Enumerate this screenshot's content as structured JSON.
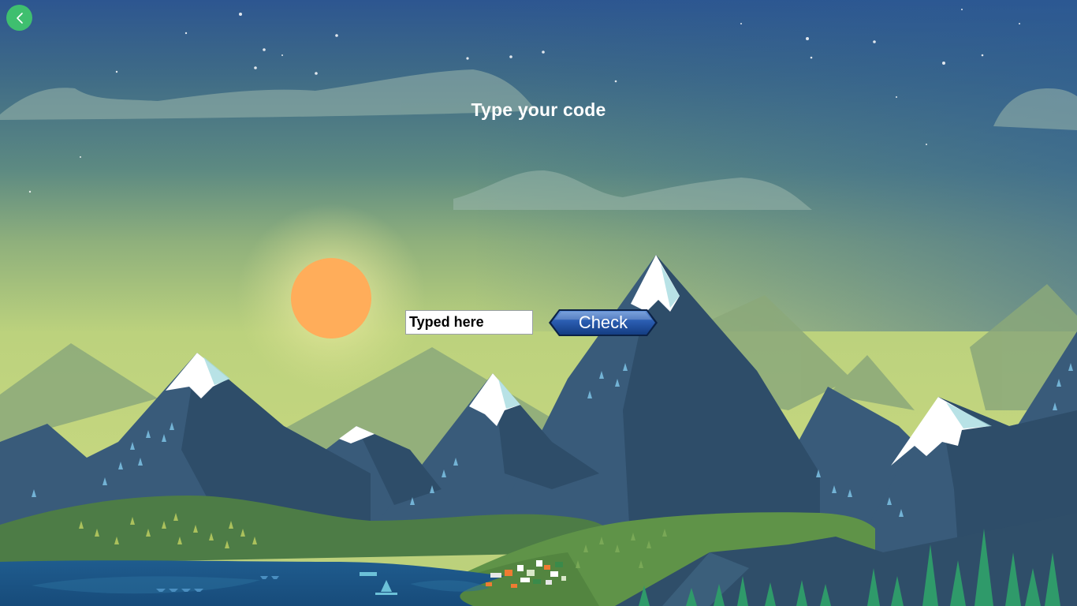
{
  "screen": {
    "title": "Type your code"
  },
  "code_input": {
    "value": "Typed here"
  },
  "check_button": {
    "label": "Check"
  },
  "back_button": {
    "icon": "chevron-left-icon"
  },
  "colors": {
    "back_button": "#3fbf6f",
    "sky_top": "#2b5a94",
    "sky_horizon": "#c3d57e",
    "sun": "#ffad5a",
    "button_blue": "#1f4f9e"
  }
}
